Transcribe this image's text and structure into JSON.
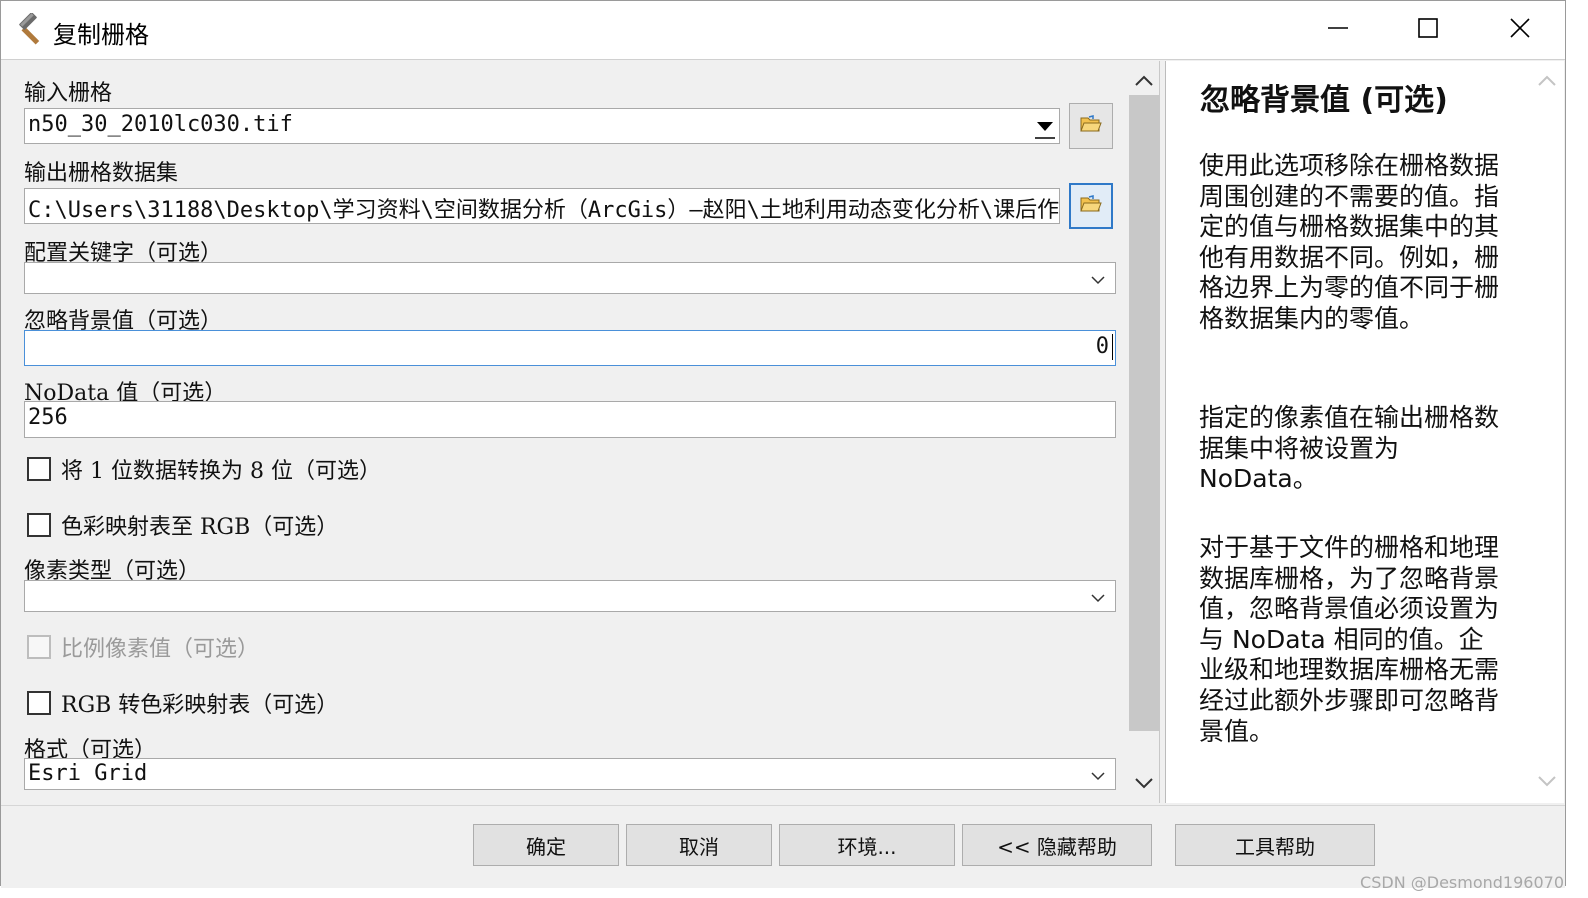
{
  "window": {
    "title": "复制栅格"
  },
  "params": {
    "input_raster": {
      "label": "输入栅格",
      "value": "n50_30_2010lc030.tif"
    },
    "output_raster": {
      "label": "输出栅格数据集",
      "value": "C:\\Users\\31188\\Desktop\\学习资料\\空间数据分析（ArcGis）—赵阳\\土地利用动态变化分析\\课后作"
    },
    "config_keyword": {
      "label": "配置关键字（可选）",
      "value": ""
    },
    "ignore_background": {
      "label": "忽略背景值（可选）",
      "value": "0"
    },
    "nodata": {
      "label": "NoData 值（可选）",
      "value": "256"
    },
    "convert_1bit": {
      "label": "将 1 位数据转换为 8 位（可选）",
      "checked": false
    },
    "colormap_to_rgb": {
      "label": "色彩映射表至 RGB（可选）",
      "checked": false
    },
    "pixel_type": {
      "label": "像素类型（可选）",
      "value": ""
    },
    "scale_pixel": {
      "label": "比例像素值（可选）",
      "checked": false,
      "disabled": true
    },
    "rgb_to_colormap": {
      "label": "RGB 转色彩映射表（可选）",
      "checked": false
    },
    "format": {
      "label": "格式（可选）",
      "value": "Esri Grid"
    }
  },
  "help": {
    "title": "忽略背景值 (可选)",
    "p1": "使用此选项移除在栅格数据周围创建的不需要的值。指定的值与栅格数据集中的其他有用数据不同。例如，栅格边界上为零的值不同于栅格数据集内的零值。",
    "p2": "指定的像素值在输出栅格数据集中将被设置为 NoData。",
    "p3": "对于基于文件的栅格和地理数据库栅格，为了忽略背景值，忽略背景值必须设置为与 NoData 相同的值。企业级和地理数据库栅格无需经过此额外步骤即可忽略背景值。"
  },
  "buttons": {
    "ok": "确定",
    "cancel": "取消",
    "environments": "环境...",
    "hide_help": "<< 隐藏帮助",
    "tool_help": "工具帮助"
  },
  "watermark": "CSDN @Desmond196070",
  "colors": {
    "accent": "#2f79c8",
    "focus": "#4a90d9",
    "panel": "#f0f0f0"
  },
  "icons": [
    "hammer-icon",
    "minimize-icon",
    "maximize-icon",
    "close-icon",
    "folder-open-icon",
    "chevron-down-icon",
    "chevron-up-icon"
  ]
}
